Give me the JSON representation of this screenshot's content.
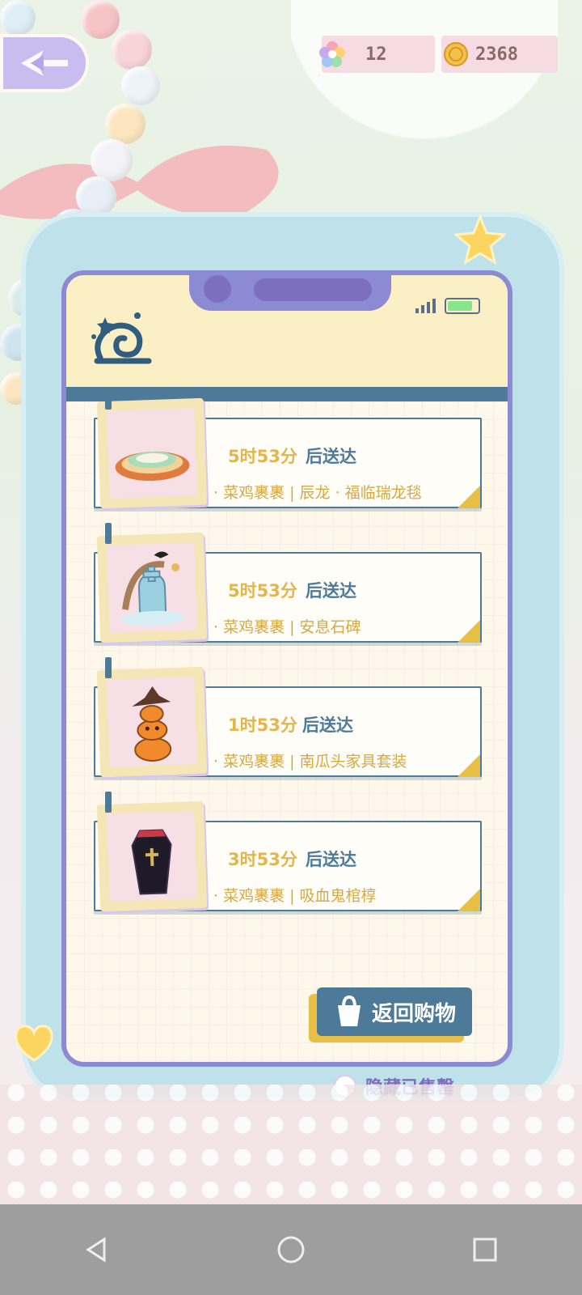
{
  "currency": {
    "stars": {
      "value": "12",
      "icon": "rainbow-flower-icon"
    },
    "coins": {
      "value": "2368",
      "icon": "gold-coin-icon"
    }
  },
  "back_button": {
    "icon": "back-arrow-icon"
  },
  "orders": [
    {
      "time": "5时53分",
      "suffix": "后送达",
      "desc": "· 菜鸡裹裹 |    辰龙 · 福临瑞龙毯",
      "thumb": "rug"
    },
    {
      "time": "5时53分",
      "suffix": "后送达",
      "desc": "· 菜鸡裹裹 |    安息石碑",
      "thumb": "tombstone"
    },
    {
      "time": "1时53分",
      "suffix": "后送达",
      "desc": "· 菜鸡裹裹 |    南瓜头家具套装",
      "thumb": "pumpkin"
    },
    {
      "time": "3时53分",
      "suffix": "后送达",
      "desc": "· 菜鸡裹裹 |    吸血鬼棺椁",
      "thumb": "coffin"
    }
  ],
  "actions": {
    "back_to_shop": "返回购物",
    "hide_sold_out": "隐藏已售罄"
  },
  "colors": {
    "accent": "#4e7a99",
    "gold": "#e4b54a",
    "frame": "#8b8ad3"
  }
}
